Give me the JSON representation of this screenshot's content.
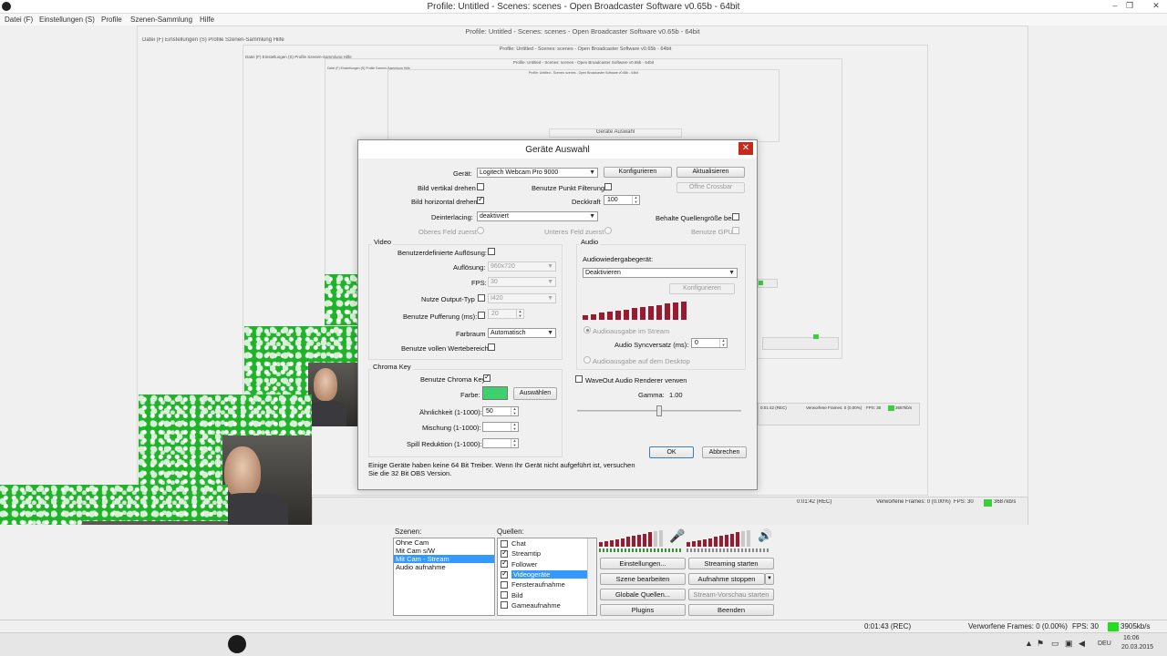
{
  "app": {
    "title": "Profile: Untitled - Scenes: scenes - Open Broadcaster Software v0.65b - 64bit",
    "menu": [
      "Datei (F)",
      "Einstellungen (S)",
      "Profile",
      "Szenen-Sammlung",
      "Hilfe"
    ],
    "window_buttons": [
      "–",
      "❐",
      "✕"
    ]
  },
  "nested": {
    "title": "Profile: Untitled - Scenes: scenes - Open Broadcaster Software v0.65b - 64bit",
    "menu": "Datei (F)   Einstellungen (S)   Profile   Szenen-Sammlung   Hilfe",
    "dialog_title": "Geräte Auswahl",
    "rec_time": "0:01:42 (REC)",
    "dropped": "Verworfene Frames: 0 (0.00%)",
    "fps": "FPS: 30",
    "bitrate": "3687kb/s"
  },
  "dialog": {
    "title": "Geräte Auswahl",
    "close": "✕",
    "device_label": "Gerät:",
    "device_value": "Logitech Webcam Pro 9000",
    "configure_button": "Konfigurieren",
    "refresh_button": "Aktualisieren",
    "flip_vertical_label": "Bild vertikal drehen",
    "flip_vertical": false,
    "flip_horizontal_label": "Bild horizontal drehen",
    "flip_horizontal": true,
    "point_filter_label": "Benutze Punkt Filterung",
    "point_filter": false,
    "crossbar_button": "Öffne Crossbar",
    "opacity_label": "Deckkraft",
    "opacity_value": "100",
    "deinterlace_label": "Deinterlacing:",
    "deinterlace_value": "deaktiviert",
    "keep_source_size_label": "Behalte Quellengröße bei",
    "top_field_label": "Oberes Feld zuerst",
    "bottom_field_label": "Unteres Feld zuerst",
    "use_gpu_label": "Benutze GPU",
    "video": {
      "group_title": "Video",
      "custom_res_label": "Benutzerdefinierte Auflösung:",
      "resolution_label": "Auflösung:",
      "resolution_value": "960x720",
      "fps_label": "FPS:",
      "fps_value": "30",
      "output_type_label": "Nutze Output-Typ",
      "output_type_value": "I420",
      "buffering_label": "Benutze Pufferung (ms):",
      "buffering_value": "20",
      "colorspace_label": "Farbraum",
      "colorspace_value": "Automatisch",
      "full_range_label": "Benutze vollen Wertebereich"
    },
    "audio": {
      "group_title": "Audio",
      "playback_label": "Audiowiedergabegerät:",
      "playback_value": "Deaktivieren",
      "configure_button": "Konfigurieren",
      "stream_output_label": "Audioausgabe im Stream",
      "sync_label": "Audio Syncversatz (ms):",
      "sync_value": "0",
      "desktop_output_label": "Audioausgabe auf dem Desktop"
    },
    "waveout_label": "WaveOut Audio Renderer verwen",
    "gamma_label": "Gamma:",
    "gamma_value": "1.00",
    "gamma_fraction": 0.5,
    "chroma": {
      "group_title": "Chroma Key",
      "use_label": "Benutze Chroma Key",
      "use": true,
      "color_label": "Farbe:",
      "color": "#3ecf6e",
      "select_button": "Auswählen",
      "similarity_label": "Ähnlichkeit (1-1000):",
      "similarity_value": "50",
      "blend_label": "Mischung (1-1000):",
      "spill_label": "Spill Reduktion (1-1000):"
    },
    "note": "Einige Geräte haben keine 64 Bit Treiber. Wenn Ihr Gerät nicht aufgeführt ist, versuchen Sie die 32 Bit OBS Version.",
    "ok_button": "OK",
    "cancel_button": "Abbrechen"
  },
  "scenes": {
    "label": "Szenen:",
    "items": [
      "Ohne Cam",
      "Mit Cam s/W",
      "Mit Cam - Stream",
      "Audio aufnahme"
    ],
    "selected_index": 2
  },
  "sources": {
    "label": "Quellen:",
    "items": [
      {
        "label": "Chat",
        "checked": false
      },
      {
        "label": "Streamtip",
        "checked": true
      },
      {
        "label": "Follower",
        "checked": true
      },
      {
        "label": "Videogeräte",
        "checked": true,
        "selected": true
      },
      {
        "label": "Fensteraufnahme",
        "checked": false
      },
      {
        "label": "Bild",
        "checked": false
      },
      {
        "label": "Gameaufnahme",
        "checked": false
      }
    ]
  },
  "controls": {
    "settings": "Einstellungen...",
    "start_streaming": "Streaming starten",
    "edit_scene": "Szene bearbeiten",
    "stop_recording": "Aufnahme stoppen",
    "global_sources": "Globale Quellen...",
    "stream_preview": "Stream-Vorschau starten",
    "plugins": "Plugins",
    "exit": "Beenden"
  },
  "status": {
    "rec_time": "0:01:43 (REC)",
    "dropped": "Verworfene Frames: 0 (0.00%)",
    "fps": "FPS: 30",
    "bitrate": "3905kb/s",
    "status_color": "#22dd22"
  },
  "taskbar": {
    "lang": "DEU",
    "time": "16:06",
    "date": "20.03.2015"
  },
  "colors": {
    "meter_red": "#9a1b30",
    "selection_blue": "#3399ff",
    "chroma_green": "#1fb32a"
  },
  "icons": [
    "obs-logo-icon",
    "microphone-icon",
    "speaker-icon",
    "minimize-icon",
    "maximize-icon",
    "close-icon"
  ]
}
